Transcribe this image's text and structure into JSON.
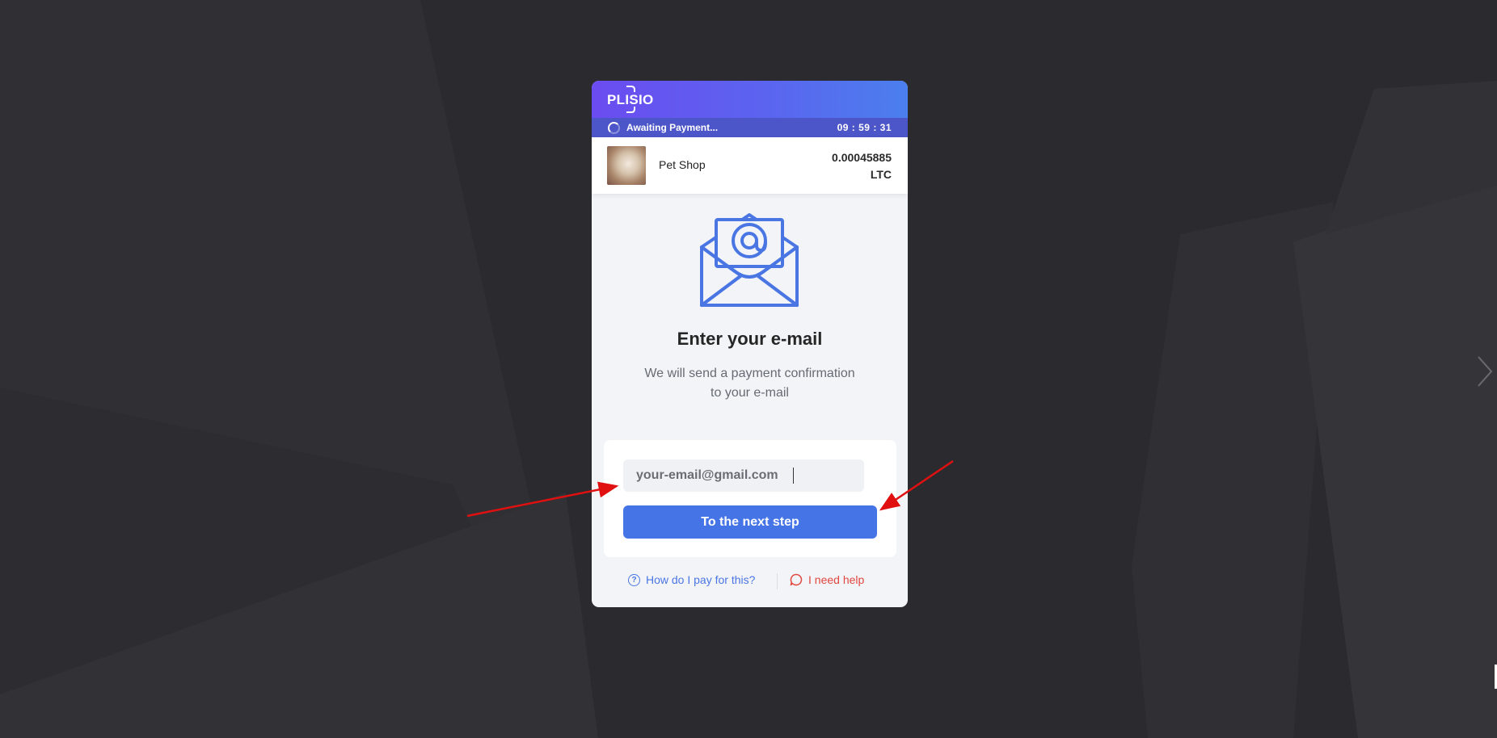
{
  "brand": {
    "logo_text": "PLISIO",
    "accent": "#4574e6",
    "header_from": "#6b4cf0",
    "header_to": "#4b7fee"
  },
  "status": {
    "text": "Awaiting Payment...",
    "timer": "09 : 59 : 31"
  },
  "merchant": {
    "name": "Pet Shop",
    "amount": "0.00045885",
    "currency": "LTC"
  },
  "email_step": {
    "icon": "envelope-at-icon",
    "title": "Enter your e-mail",
    "subtitle_line1": "We will send a payment confirmation",
    "subtitle_line2": "to your e-mail",
    "email_value": "your-email@gmail.com",
    "button_label": "To the next step"
  },
  "footer": {
    "help_label": "How do I pay for this?",
    "help_icon": "question-circle-icon",
    "support_label": "I need help",
    "support_icon": "chat-bubble-icon",
    "help_color": "#4a76e3",
    "support_color": "#e0473f"
  },
  "annotations": {
    "arrow_color": "#e01010"
  }
}
